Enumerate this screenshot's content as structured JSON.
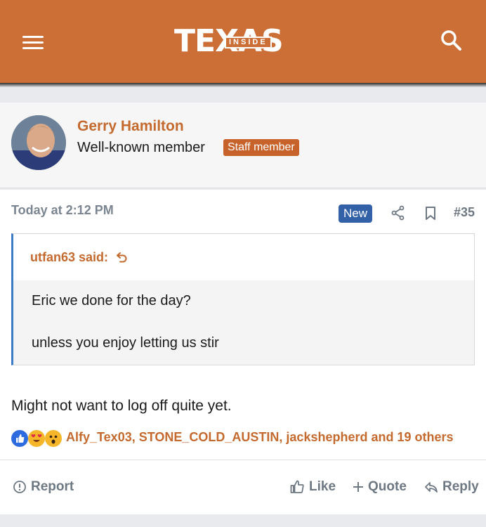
{
  "header": {
    "logo_main": "TEXAS",
    "logo_inside": "INSIDE",
    "menu_icon": "hamburger-menu-icon",
    "search_icon": "search-icon",
    "brand_color": "#cc6f37"
  },
  "author": {
    "name": "Gerry Hamilton",
    "title": "Well-known member",
    "badge": "Staff member"
  },
  "post": {
    "date": "Today at 2:12 PM",
    "new_label": "New",
    "number": "#35",
    "quote": {
      "author": "utfan63 said:",
      "line1": "Eric we done for the day?",
      "line2": "unless you enjoy letting us stir"
    },
    "body": "Might not want to log off quite yet.",
    "reactions": {
      "icons": [
        "like-reaction-icon",
        "love-reaction-icon",
        "wow-reaction-icon"
      ],
      "text": "Alfy_Tex03, STONE_COLD_AUSTIN, jackshepherd and 19 others"
    }
  },
  "actions": {
    "report": "Report",
    "like": "Like",
    "quote": "Quote",
    "reply": "Reply"
  }
}
